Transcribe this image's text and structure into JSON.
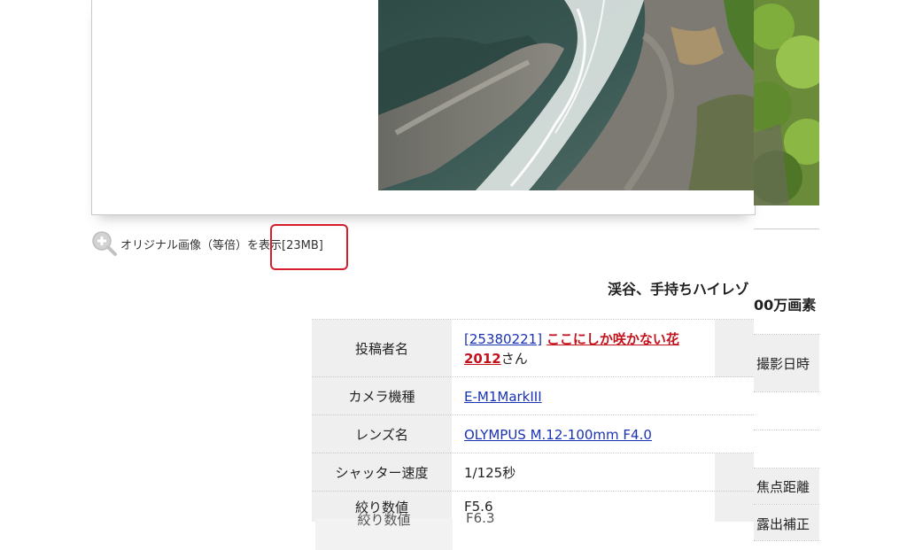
{
  "zoom_link": {
    "text": "オリジナル画像（等倍）を表示",
    "size": "[23MB]"
  },
  "post_title": {
    "part1": "渓谷、手持ちハイレゾ",
    "part2": "00万画素"
  },
  "spec_rows": [
    {
      "label": "投稿者名",
      "id_link": "[25380221]",
      "name_line1": "ここにしか咲かない花",
      "name_line2": "2012",
      "suffix": "さん"
    },
    {
      "label": "カメラ機種",
      "value": "E-M1MarkIII"
    },
    {
      "label": "レンズ名",
      "value": "OLYMPUS M.12-100mm F4.0"
    },
    {
      "label": "シャッター速度",
      "value": "1/125秒"
    },
    {
      "label": "絞り数値",
      "value": "F5.6"
    }
  ],
  "ghost_row": {
    "label": "絞り数値",
    "value": "F6.3"
  },
  "side_labels": {
    "date": "撮影日時",
    "focal": "焦点距離",
    "exposure": "露出補正"
  },
  "colors": {
    "link": "#1a32b4",
    "link_red": "#c4121d",
    "highlight": "#d61f2c",
    "th_bg": "#efefef"
  }
}
